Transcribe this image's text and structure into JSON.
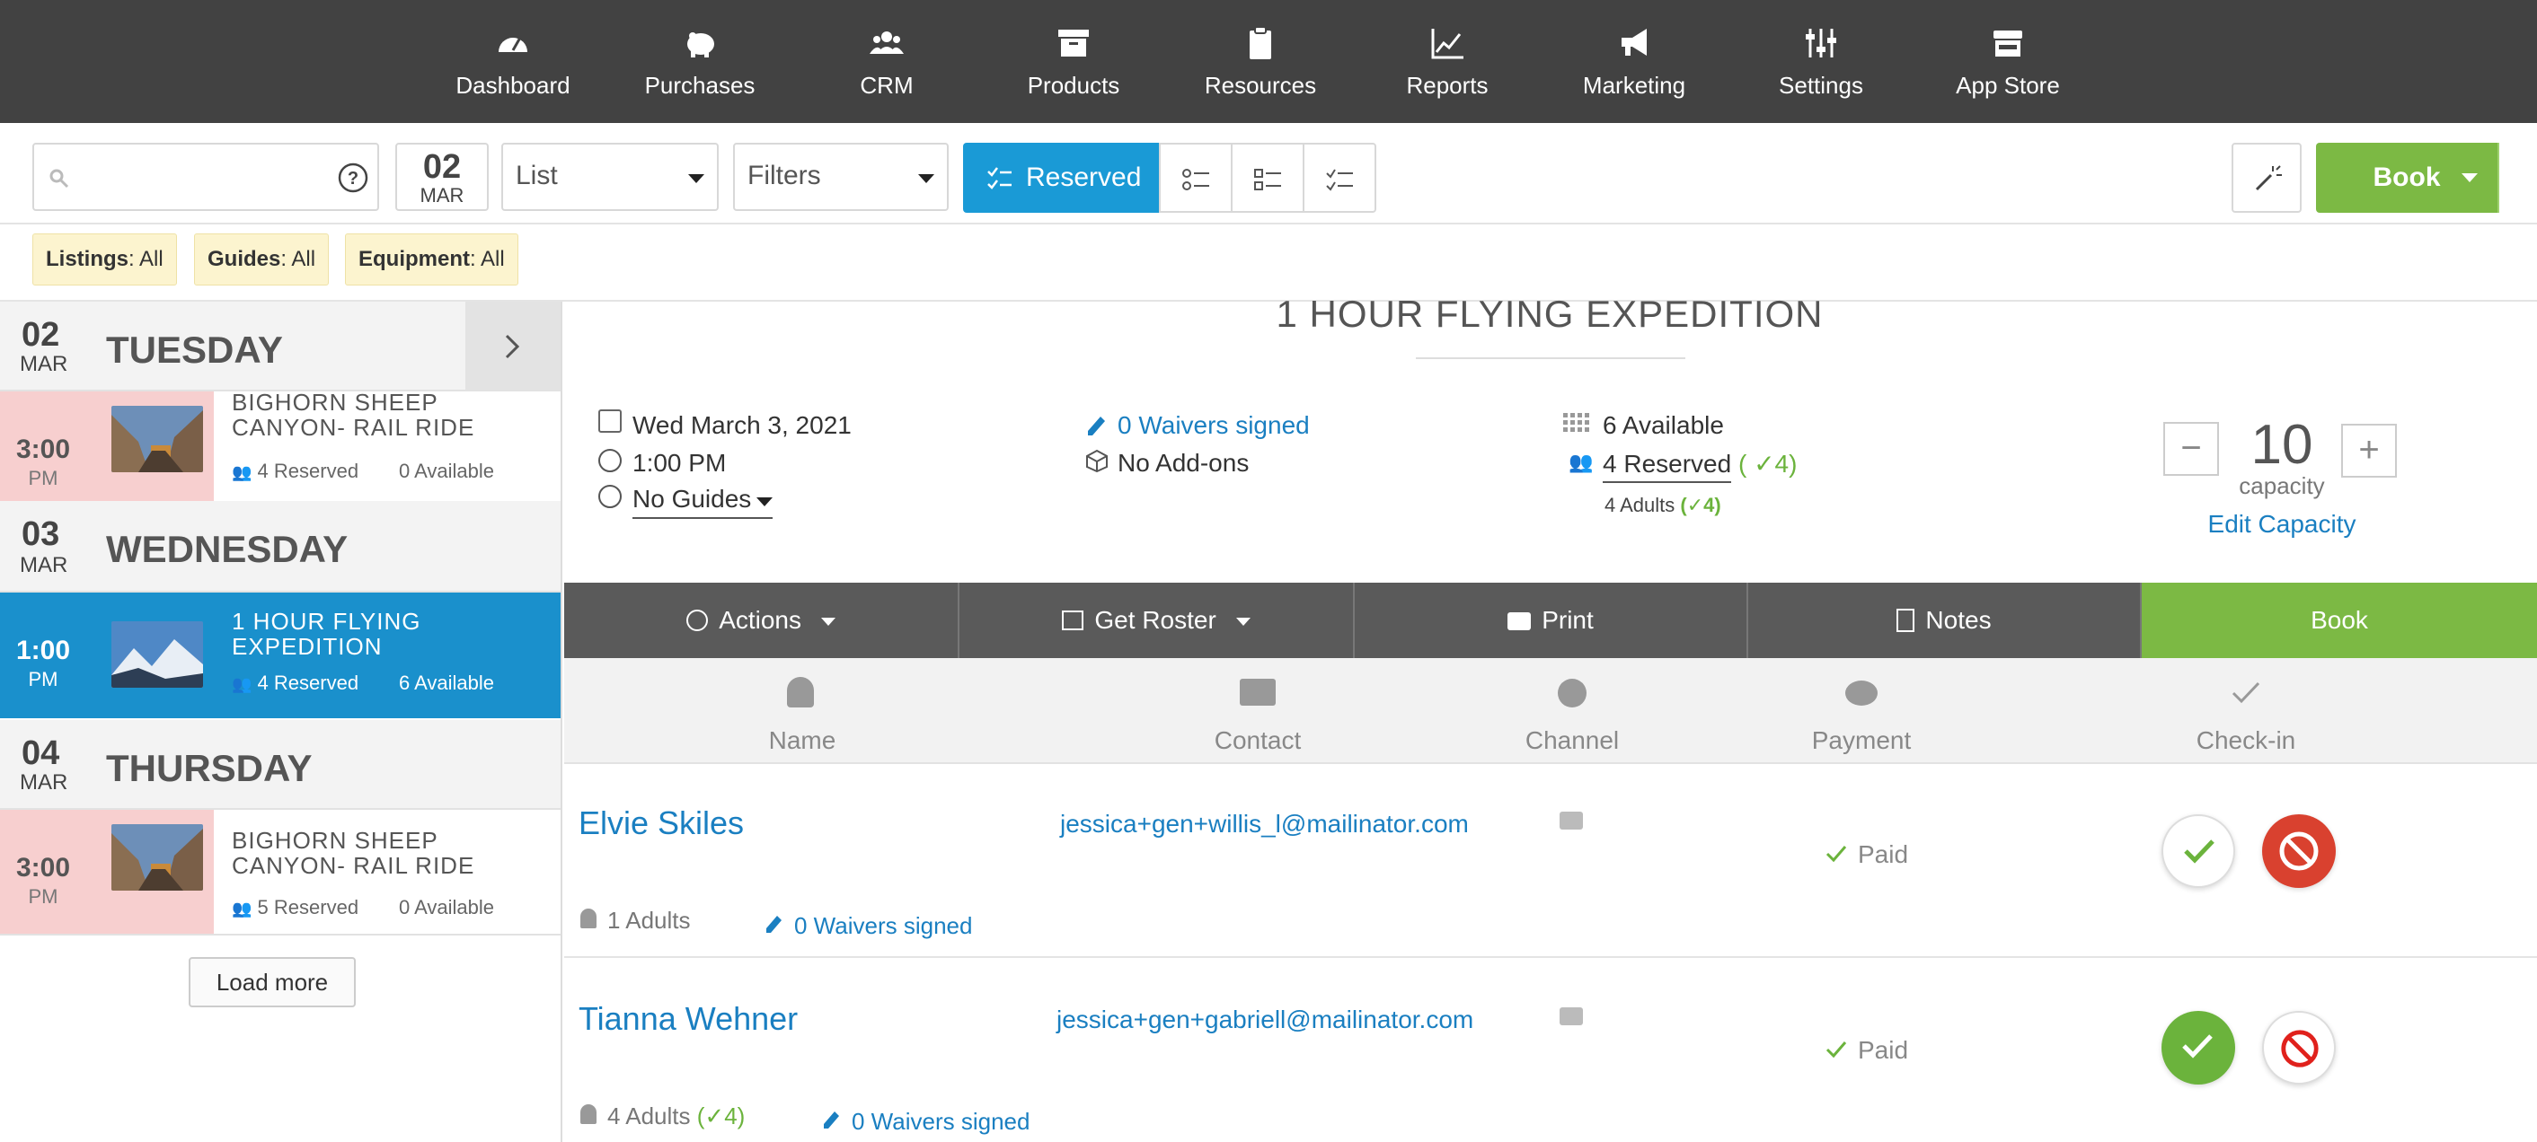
{
  "nav": {
    "items": [
      {
        "label": "Dashboard",
        "icon": "dashboard-icon"
      },
      {
        "label": "Purchases",
        "icon": "piggy-bank-icon"
      },
      {
        "label": "CRM",
        "icon": "users-icon"
      },
      {
        "label": "Products",
        "icon": "archive-box-icon"
      },
      {
        "label": "Resources",
        "icon": "clipboard-icon"
      },
      {
        "label": "Reports",
        "icon": "line-chart-icon"
      },
      {
        "label": "Marketing",
        "icon": "megaphone-icon"
      },
      {
        "label": "Settings",
        "icon": "sliders-icon"
      },
      {
        "label": "App Store",
        "icon": "store-icon"
      }
    ]
  },
  "toolbar": {
    "search_placeholder": "",
    "date_day": "02",
    "date_month": "MAR",
    "view_select": "List",
    "filters_select": "Filters",
    "reserved_label": "Reserved",
    "book_label": "Book"
  },
  "filters": {
    "listings_label": "Listings",
    "listings_value": ": All",
    "guides_label": "Guides",
    "guides_value": ": All",
    "equipment_label": "Equipment",
    "equipment_value": ": All"
  },
  "sidebar": {
    "days": [
      {
        "num": "02",
        "month": "MAR",
        "name": "TUESDAY",
        "events": [
          {
            "time": "3:00",
            "ampm": "PM",
            "title": "BIGHORN SHEEP CANYON- RAIL RIDE",
            "reserved": "4 Reserved",
            "available": "0 Available"
          }
        ]
      },
      {
        "num": "03",
        "month": "MAR",
        "name": "WEDNESDAY",
        "events": [
          {
            "time": "1:00",
            "ampm": "PM",
            "title": "1 HOUR FLYING EXPEDITION",
            "reserved": "4 Reserved",
            "available": "6 Available"
          }
        ]
      },
      {
        "num": "04",
        "month": "MAR",
        "name": "THURSDAY",
        "events": [
          {
            "time": "3:00",
            "ampm": "PM",
            "title": "BIGHORN SHEEP CANYON- RAIL RIDE",
            "reserved": "5 Reserved",
            "available": "0 Available"
          }
        ]
      }
    ],
    "load_more": "Load more"
  },
  "detail": {
    "title": "1 HOUR FLYING EXPEDITION",
    "date": "Wed March 3, 2021",
    "time": "1:00 PM",
    "guides": "No Guides",
    "waivers": "0 Waivers signed",
    "addons": "No Add-ons",
    "available": "6 Available",
    "reserved": "4 Reserved",
    "reserved_checked": "( ✓4)",
    "adults": "4 Adults",
    "adults_checked": "(✓4)",
    "capacity_value": "10",
    "capacity_label": "capacity",
    "edit_capacity": "Edit Capacity"
  },
  "actions": {
    "actions_label": "Actions",
    "roster_label": "Get Roster",
    "print_label": "Print",
    "notes_label": "Notes",
    "book_label": "Book"
  },
  "columns": {
    "name": "Name",
    "contact": "Contact",
    "channel": "Channel",
    "payment": "Payment",
    "checkin": "Check-in"
  },
  "bookings": [
    {
      "name": "Elvie Skiles",
      "email": "jessica+gen+willis_l@mailinator.com",
      "payment": "Paid",
      "adults": "1 Adults",
      "adults_checked": "",
      "waivers": "0 Waivers signed",
      "checked_in": false
    },
    {
      "name": "Tianna Wehner",
      "email": "jessica+gen+gabriell@mailinator.com",
      "payment": "Paid",
      "adults": "4 Adults",
      "adults_checked": "(✓4)",
      "waivers": "0 Waivers signed",
      "checked_in": true
    }
  ],
  "colors": {
    "nav_bg": "#424242",
    "accent_blue": "#1a90cc",
    "book_green": "#7cb944",
    "danger_red": "#d9412f",
    "chip_yellow": "#fcf4cf"
  }
}
